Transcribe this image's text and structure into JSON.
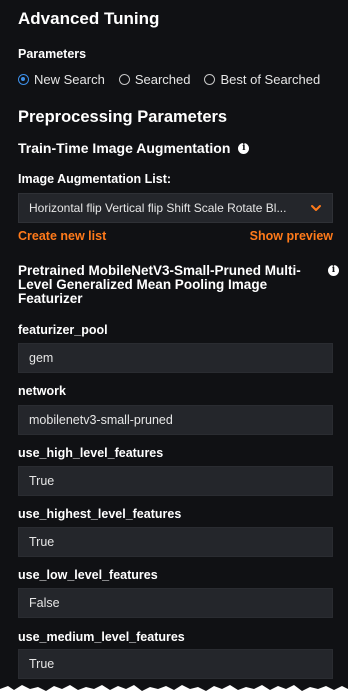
{
  "title": "Advanced Tuning",
  "parameters_label": "Parameters",
  "radios": [
    {
      "label": "New Search",
      "selected": true
    },
    {
      "label": "Searched",
      "selected": false
    },
    {
      "label": "Best of Searched",
      "selected": false
    }
  ],
  "preprocessing_title": "Preprocessing Parameters",
  "augmentation": {
    "title": "Train-Time Image Augmentation",
    "list_label": "Image Augmentation List:",
    "selected_value": "Horizontal flip Vertical flip Shift Scale Rotate Bl...",
    "create_link": "Create new list",
    "preview_link": "Show preview"
  },
  "featurizer_title": "Pretrained MobileNetV3-Small-Pruned Multi-Level Generalized Mean Pooling Image Featurizer",
  "fields": [
    {
      "label": "featurizer_pool",
      "value": "gem"
    },
    {
      "label": "network",
      "value": "mobilenetv3-small-pruned"
    },
    {
      "label": "use_high_level_features",
      "value": "True"
    },
    {
      "label": "use_highest_level_features",
      "value": "True"
    },
    {
      "label": "use_low_level_features",
      "value": "False"
    },
    {
      "label": "use_medium_level_features",
      "value": "True"
    }
  ],
  "colors": {
    "accent_link": "#ff7a1a",
    "radio_selected": "#3d8fe8",
    "background": "#101114",
    "field_bg": "#24262b"
  }
}
